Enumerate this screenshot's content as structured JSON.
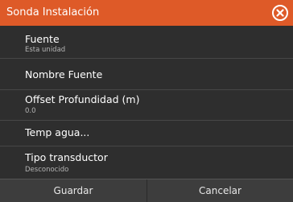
{
  "dialog": {
    "title": "Sonda Instalación",
    "close_icon": "close-circle-icon"
  },
  "items": [
    {
      "label": "Fuente",
      "value": "Esta unidad"
    },
    {
      "label": "Nombre Fuente",
      "value": ""
    },
    {
      "label": "Offset Profundidad (m)",
      "value": "0.0"
    },
    {
      "label": "Temp agua...",
      "value": ""
    },
    {
      "label": "Tipo transductor",
      "value": "Desconocido"
    }
  ],
  "footer": {
    "save_label": "Guardar",
    "cancel_label": "Cancelar"
  },
  "colors": {
    "header": "#de5a28",
    "background": "#2e2e2e",
    "footer": "#3d3d3d"
  }
}
